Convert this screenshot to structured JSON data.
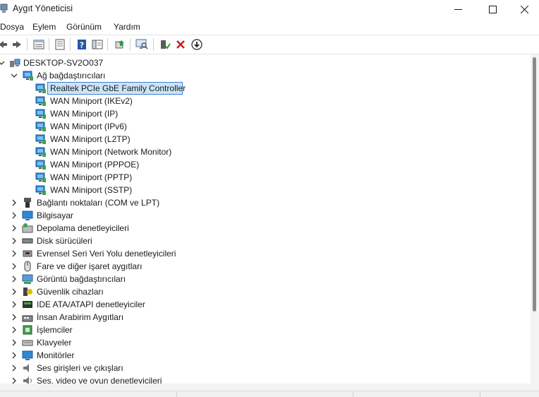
{
  "window": {
    "title": "Aygıt Yöneticisi",
    "controls": [
      "minimize-icon",
      "maximize-icon",
      "close-icon"
    ]
  },
  "menu": [
    "Dosya",
    "Eylem",
    "Görünüm",
    "Yardım"
  ],
  "toolbar": {
    "icons": [
      "back-arrow-icon",
      "forward-arrow-icon",
      "properties-icon",
      "view-list-icon",
      "help-icon",
      "console-tree-icon",
      "update-driver-icon",
      "scan-hardware-icon",
      "enable-device-icon",
      "uninstall-device-icon",
      "disable-device-icon"
    ]
  },
  "tree": {
    "root": "DESKTOP-SV2O037",
    "expanded_category": "Ağ bağdaştırıcıları",
    "adapters": [
      "Realtek PCIe GbE Family Controller",
      "WAN Miniport (IKEv2)",
      "WAN Miniport (IP)",
      "WAN Miniport (IPv6)",
      "WAN Miniport (L2TP)",
      "WAN Miniport (Network Monitor)",
      "WAN Miniport (PPPOE)",
      "WAN Miniport (PPTP)",
      "WAN Miniport (SSTP)"
    ],
    "selected": "Realtek PCIe GbE Family Controller",
    "categories": [
      "Bağlantı noktaları (COM ve LPT)",
      "Bilgisayar",
      "Depolama denetleyicileri",
      "Disk sürücüleri",
      "Evrensel Seri Veri Yolu denetleyicileri",
      "Fare ve diğer işaret aygıtları",
      "Görüntü bağdaştırıcıları",
      "Güvenlik cihazları",
      "IDE ATA/ATAPI denetleyiciler",
      "İnsan Arabirim Aygıtları",
      "İşlemciler",
      "Klavyeler",
      "Monitörler",
      "Ses girişleri ve çıkışları",
      "Ses, video ve oyun denetleyicileri"
    ],
    "category_icons": [
      "port-icon",
      "computer-icon",
      "storage-controller-icon",
      "disk-drive-icon",
      "usb-icon",
      "mouse-icon",
      "display-adapter-icon",
      "security-device-icon",
      "ide-icon",
      "hid-icon",
      "processor-icon",
      "keyboard-icon",
      "monitor-icon",
      "audio-io-icon",
      "sound-controller-icon"
    ]
  },
  "colors": {
    "selection_fill": "#cce4f7",
    "selection_border": "#3b7fd6",
    "network_icon": "#2f87d6",
    "close_red": "#d61f1f",
    "enable_green": "#2a9d3a"
  }
}
